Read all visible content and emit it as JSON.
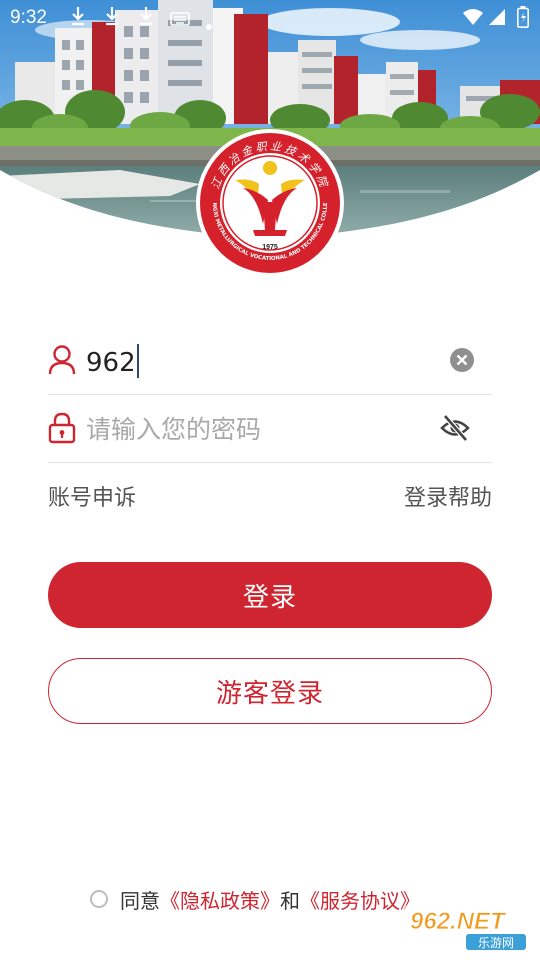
{
  "status_bar": {
    "time": "9:32",
    "icons": [
      "download-icon",
      "download-icon",
      "download-icon",
      "keyboard-icon",
      "dot-icon",
      "wifi-icon",
      "signal-icon",
      "battery-icon"
    ]
  },
  "school": {
    "emblem_year": "1975",
    "emblem_motto": "江西冶金职业技术学院",
    "emblem_english": "JIANGXI METALLURGICAL VOCATIONAL AND TECHNICAL COLLEGE"
  },
  "login_form": {
    "username_value": "962",
    "password_placeholder": "请输入您的密码",
    "icons": {
      "username": "user-icon",
      "password": "lock-icon",
      "clear": "clear-icon",
      "visibility": "eye-off-icon"
    }
  },
  "links": {
    "account_appeal": "账号申诉",
    "login_help": "登录帮助"
  },
  "buttons": {
    "login": "登录",
    "guest_login": "游客登录"
  },
  "agreement": {
    "prefix": "同意",
    "privacy_policy": "《隐私政策》",
    "conjunction": "和",
    "service_agreement": "《服务协议》"
  },
  "watermark": {
    "brand": "962.NET",
    "site": "乐游网"
  },
  "colors": {
    "accent": "#cf2530",
    "placeholder": "#a9a9a9",
    "link_text": "#555555"
  }
}
